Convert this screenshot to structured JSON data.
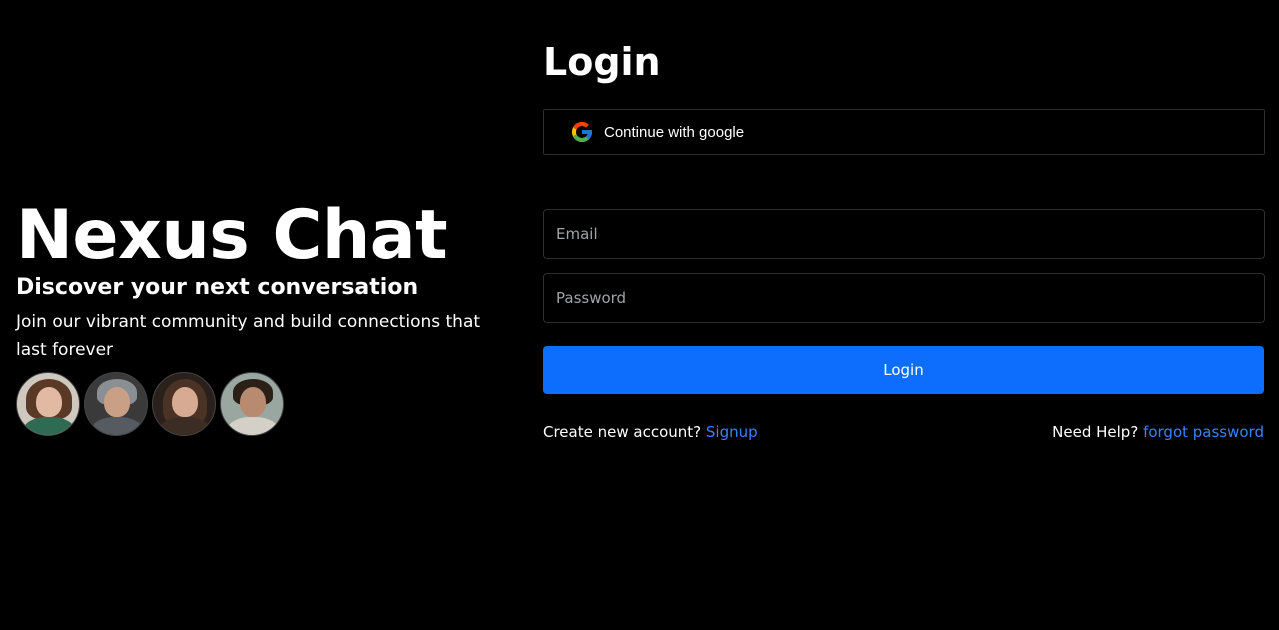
{
  "hero": {
    "title": "Nexus Chat",
    "subtitle": "Discover your next conversation",
    "description": "Join our vibrant community and build connections that last forever",
    "avatars": [
      "avatar-1",
      "avatar-2",
      "avatar-3",
      "avatar-4"
    ]
  },
  "login": {
    "title": "Login",
    "google_label": "Continue with google",
    "email_placeholder": "Email",
    "password_placeholder": "Password",
    "submit_label": "Login",
    "signup_prompt": "Create new account?",
    "signup_link": "Signup",
    "help_prompt": "Need Help?",
    "forgot_link": "forgot password"
  },
  "colors": {
    "background": "#000000",
    "primary": "#0d6efd",
    "link": "#3b82f6",
    "border": "#2e2e2e"
  }
}
